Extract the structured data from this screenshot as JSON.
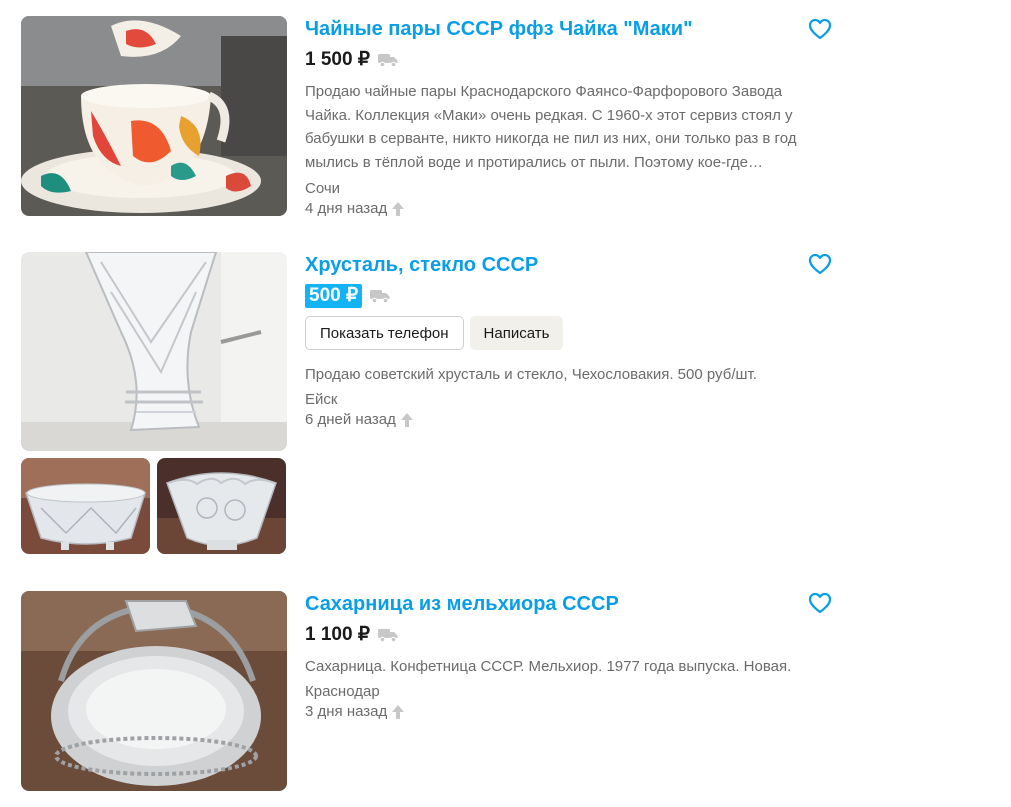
{
  "listings": [
    {
      "title": "Чайные пары СССР ффз Чайка \"Маки\"",
      "price": "1 500 ₽",
      "description": "Продаю чайные пары Краснодарского Фаянсо-Фарфорового Завода Чайка. Коллекция «Маки» очень редкая. С 1960-х этот сервиз стоял у бабушки в серванте, никто никогда не пил из них, они только раз в год мылись в тёплой воде и протирались от пыли. Поэтому кое-где…",
      "city": "Сочи",
      "date": "4 дня назад"
    },
    {
      "title": "Хрусталь, стекло СССР",
      "price": "500 ₽",
      "show_phone_label": "Показать телефон",
      "write_label": "Написать",
      "description": "Продаю советский хрусталь и стекло, Чехословакия. 500 руб/шт.",
      "city": "Ейск",
      "date": "6 дней назад"
    },
    {
      "title": "Сахарница из мельхиора СССР",
      "price": "1 100 ₽",
      "description": "Сахарница. Конфетница СССР. Мельхиор. 1977 года выпуска. Новая.",
      "city": "Краснодар",
      "date": "3 дня назад"
    }
  ],
  "colors": {
    "link": "#0a9ee6",
    "price_highlight": "#13b3f6",
    "muted_text": "#6b6b6b",
    "icon_gray": "#c7c7c7"
  },
  "icons": [
    "heart-icon",
    "delivery-truck-icon",
    "raise-arrow-icon"
  ]
}
